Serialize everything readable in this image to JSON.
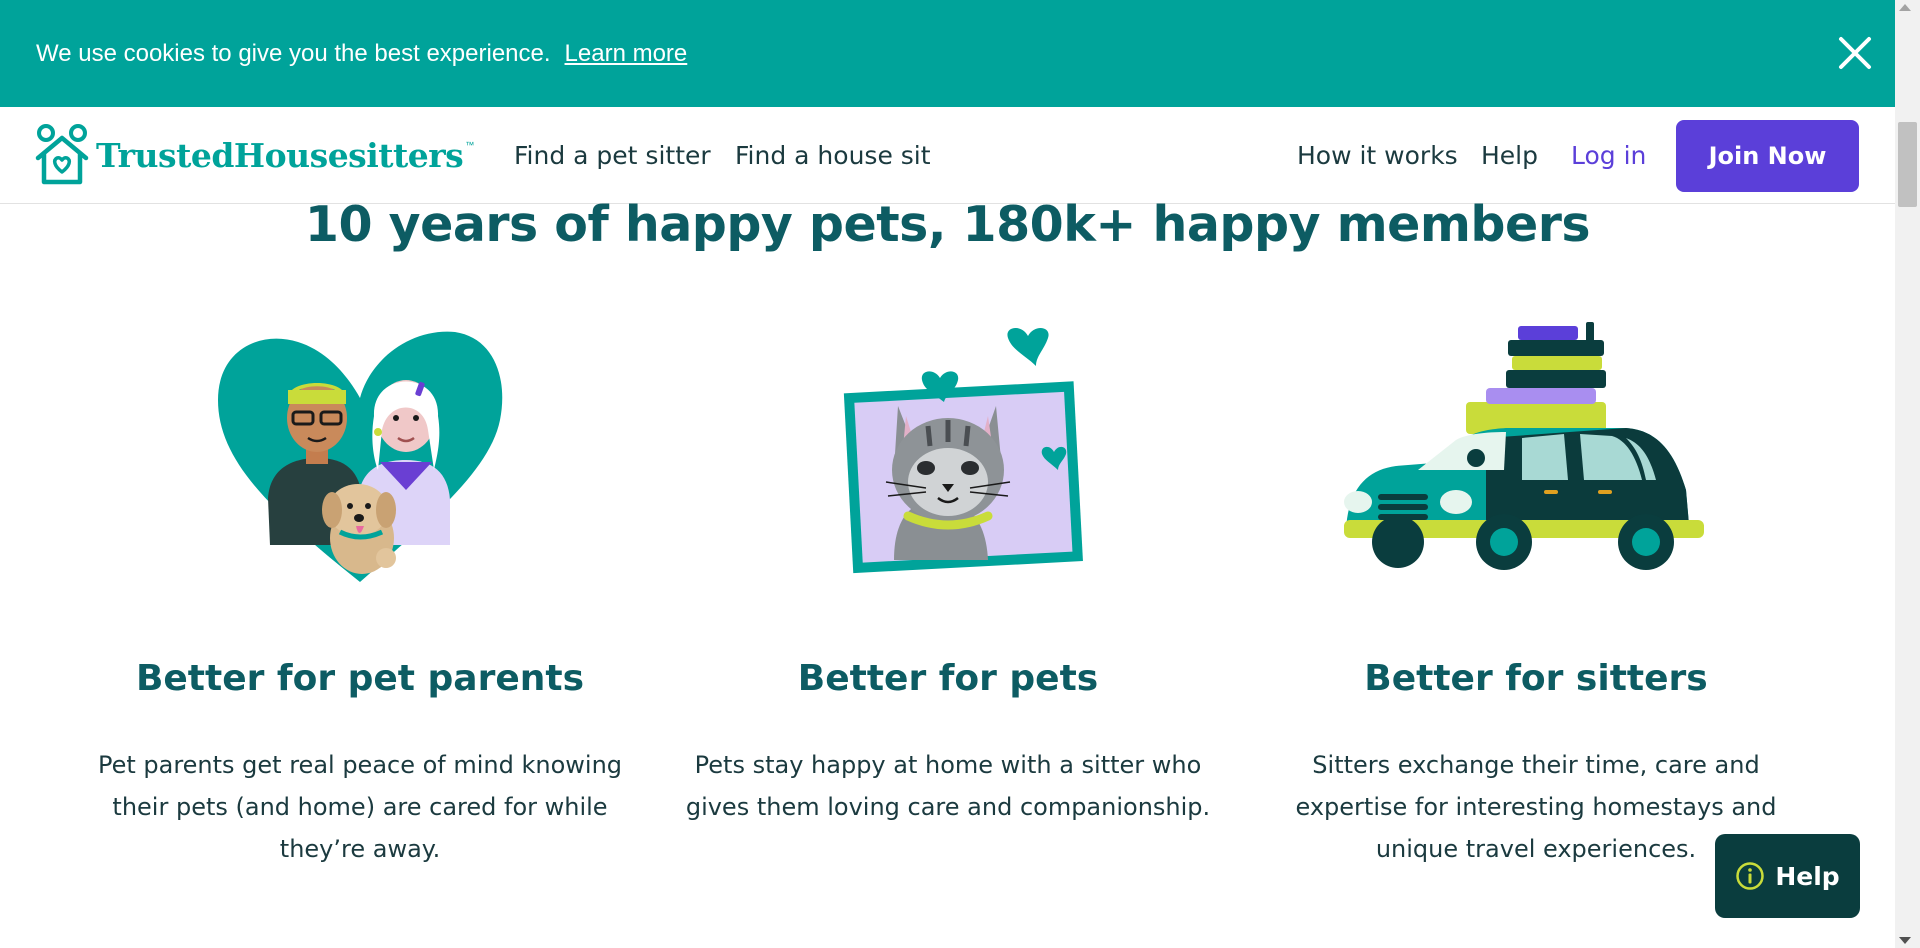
{
  "cookie_banner": {
    "message": "We use cookies to give you the best experience.",
    "link_label": "Learn more",
    "close_icon": "close-icon"
  },
  "header": {
    "logo_text": "TrustedHousesitters",
    "logo_tm": "™",
    "nav": {
      "find_sitter": "Find a pet sitter",
      "find_sit": "Find a house sit",
      "how_it_works": "How it works",
      "help": "Help",
      "login": "Log in"
    },
    "join_label": "Join Now"
  },
  "main": {
    "headline": "10 years of happy pets, 180k+ happy members",
    "features": [
      {
        "title": "Better for pet parents",
        "body": "Pet parents get real peace of mind knowing their pets (and home) are cared for while they’re away.",
        "illustration": "heart-people-dog-illustration"
      },
      {
        "title": "Better for pets",
        "body": "Pets stay happy at home with a sitter who gives them loving care and companionship.",
        "illustration": "cat-portrait-illustration"
      },
      {
        "title": "Better for sitters",
        "body": "Sitters exchange their time, care and expertise for interesting homestays and unique travel experiences.",
        "illustration": "car-luggage-illustration"
      }
    ]
  },
  "help_widget": {
    "label": "Help",
    "icon": "info-icon"
  },
  "colors": {
    "teal": "#00a39a",
    "dark_teal": "#0d5c63",
    "purple": "#5b3fd9",
    "help_bg": "#0a3d3e"
  }
}
